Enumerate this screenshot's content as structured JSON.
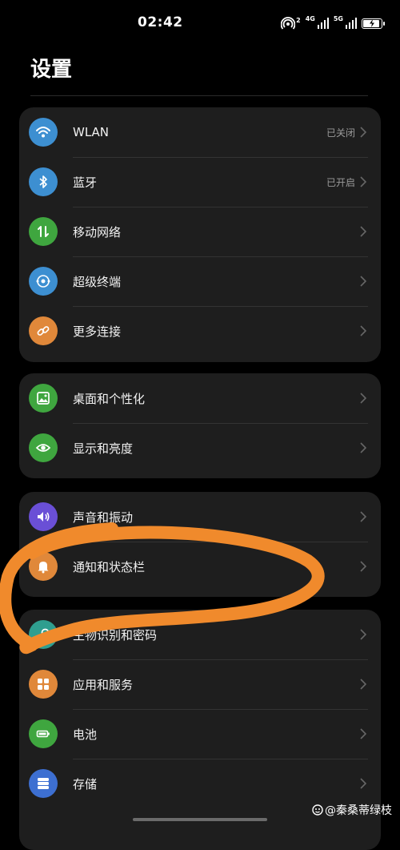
{
  "status_bar": {
    "time": "02:42",
    "hotspot_count": "2",
    "net1_label": "4G",
    "net2_label": "5G"
  },
  "header": {
    "title": "设置"
  },
  "sections": [
    {
      "items": [
        {
          "label": "WLAN",
          "value": "已关闭",
          "icon": "wifi-icon",
          "color": "#3d8fd1"
        },
        {
          "label": "蓝牙",
          "value": "已开启",
          "icon": "bluetooth-icon",
          "color": "#3d8fd1"
        },
        {
          "label": "移动网络",
          "value": "",
          "icon": "mobile-data-icon",
          "color": "#3fa63f"
        },
        {
          "label": "超级终端",
          "value": "",
          "icon": "super-device-icon",
          "color": "#3d8fd1"
        },
        {
          "label": "更多连接",
          "value": "",
          "icon": "link-icon",
          "color": "#e0883a"
        }
      ]
    },
    {
      "items": [
        {
          "label": "桌面和个性化",
          "value": "",
          "icon": "wallpaper-icon",
          "color": "#3fa63f"
        },
        {
          "label": "显示和亮度",
          "value": "",
          "icon": "eye-icon",
          "color": "#3fa63f"
        }
      ]
    },
    {
      "items": [
        {
          "label": "声音和振动",
          "value": "",
          "icon": "speaker-icon",
          "color": "#6a4fd6"
        },
        {
          "label": "通知和状态栏",
          "value": "",
          "icon": "bell-icon",
          "color": "#e0883a"
        }
      ]
    },
    {
      "items": [
        {
          "label": "生物识别和密码",
          "value": "",
          "icon": "key-icon",
          "color": "#2f9e8f"
        },
        {
          "label": "应用和服务",
          "value": "",
          "icon": "apps-icon",
          "color": "#e0883a"
        },
        {
          "label": "电池",
          "value": "",
          "icon": "battery-icon",
          "color": "#3fa63f"
        },
        {
          "label": "存储",
          "value": "",
          "icon": "storage-icon",
          "color": "#3d6fd1"
        }
      ]
    }
  ],
  "watermark": {
    "text": "@秦桑蒂绿枝"
  },
  "annotation": {
    "color": "#f08a2c"
  }
}
